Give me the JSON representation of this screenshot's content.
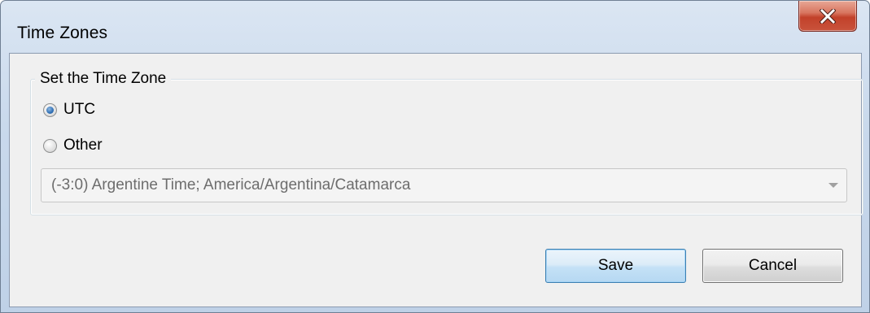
{
  "window": {
    "title": "Time Zones"
  },
  "titlebar": {
    "close_icon": "close-x-icon"
  },
  "group": {
    "legend": "Set the Time Zone",
    "options": [
      {
        "label": "UTC",
        "selected": true
      },
      {
        "label": "Other",
        "selected": false
      }
    ],
    "timezone_select": {
      "value": "(-3:0) Argentine Time; America/Argentina/Catamarca",
      "disabled": true
    }
  },
  "buttons": {
    "save_label": "Save",
    "cancel_label": "Cancel"
  },
  "colors": {
    "close_button": "#c9533c",
    "save_button_border": "#3c7fb1",
    "radio_selected": "#2f6fb5"
  }
}
